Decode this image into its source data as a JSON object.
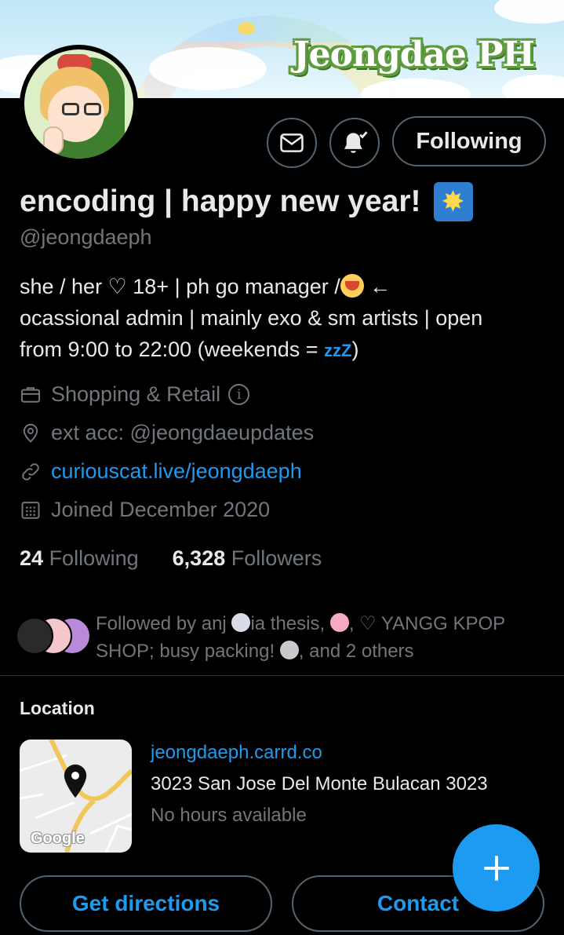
{
  "banner": {
    "title": "Jeongdae PH"
  },
  "actions": {
    "following_label": "Following"
  },
  "profile": {
    "display_name": "encoding | happy new year!",
    "handle": "@jeongdaeph",
    "bio_line1": "she / her ♡ 18+ | ph go manager /",
    "bio_arrow": " ←",
    "bio_line2": "ocassional admin | mainly exo & sm artists | open",
    "bio_line3": "from 9:00 to 22:00 (weekends = ",
    "bio_zzz": "zzZ",
    "bio_close": ")"
  },
  "meta": {
    "category": "Shopping & Retail",
    "location": "ext acc: @jeongdaeupdates",
    "website": "curiouscat.live/jeongdaeph",
    "joined": "Joined December 2020"
  },
  "stats": {
    "following_count": "24",
    "following_label": "Following",
    "followers_count": "6,328",
    "followers_label": "Followers"
  },
  "followed_by": {
    "part1": "Followed by anj ",
    "part2": "ia thesis, ",
    "part3": ", ♡ YANGG KPOP SHOP; busy packing! ",
    "part4": ", and 2 others"
  },
  "location_card": {
    "title": "Location",
    "map_label": "Google",
    "link": "jeongdaeph.carrd.co",
    "address": "3023 San Jose Del Monte Bulacan 3023",
    "hours": "No hours available"
  },
  "buttons": {
    "directions": "Get directions",
    "contact": "Contact"
  },
  "colors": {
    "accent": "#1d9bf0",
    "background": "#000000",
    "text_primary": "#e7e9ea",
    "text_secondary": "#71767b",
    "border": "#536471"
  },
  "icons": [
    "mail-icon",
    "bell-check-icon",
    "briefcase-icon",
    "location-pin-icon",
    "link-icon",
    "calendar-icon",
    "plus-icon",
    "map-pin-icon"
  ]
}
